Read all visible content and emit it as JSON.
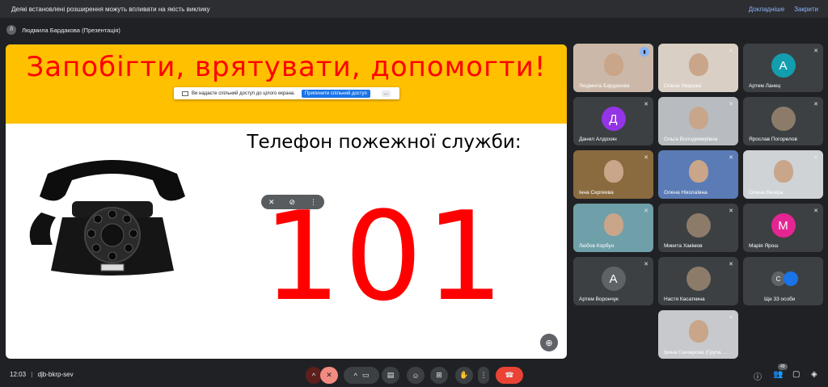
{
  "banner": {
    "message": "Деякі встановлені розширення можуть впливати на якість виклику",
    "details": "Докладніше",
    "close": "Закрити"
  },
  "presenter": {
    "initial": "Л",
    "label": "Людмила Бардакова (Презентація)"
  },
  "slide": {
    "title": "Запобігти, врятувати, допомогти!",
    "subtitle": "Телефон пожежної служби:",
    "number": "101",
    "share_notice": {
      "text": "Ви надаєте спільний доступ до цілого екрана.",
      "stop": "Припинити спільний доступ",
      "more": "..."
    }
  },
  "participants": [
    {
      "name": "Людмила Бардакова",
      "type": "video",
      "color": "#cbb8a8",
      "active": true
    },
    {
      "name": "Олена Уварова",
      "type": "video",
      "color": "#d9cfc4"
    },
    {
      "name": "Артем Ланец",
      "type": "avatar",
      "initial": "А",
      "color": "#129eaf"
    },
    {
      "name": "Данил Алдохин",
      "type": "avatar",
      "initial": "Д",
      "color": "#9334e6"
    },
    {
      "name": "Ольга Володимирівна",
      "type": "video",
      "color": "#b8bcc0"
    },
    {
      "name": "Ярослав Погорелов",
      "type": "photo",
      "color": "#3c4043"
    },
    {
      "name": "Інна Сергеева",
      "type": "video",
      "color": "#8a6b3f"
    },
    {
      "name": "Олена Ніколаївна",
      "type": "video",
      "color": "#5a7bb5"
    },
    {
      "name": "Олена Вегера",
      "type": "video",
      "color": "#cfd3d6"
    },
    {
      "name": "Любов Корбун",
      "type": "video",
      "color": "#6f9fa8"
    },
    {
      "name": "Микита Хакімов",
      "type": "photo",
      "color": "#3c4043"
    },
    {
      "name": "Марія Ярош",
      "type": "avatar",
      "initial": "М",
      "color": "#e52592"
    },
    {
      "name": "Артем Ворончук",
      "type": "avatar",
      "initial": "А",
      "color": "#5f6368"
    },
    {
      "name": "Настя Касаткина",
      "type": "photo",
      "color": "#3c4043"
    },
    {
      "name": "Ще 33 особи",
      "type": "more",
      "initial": "С",
      "color": "#5f6368"
    },
    {
      "name": "Ірина Гончарова (Група ...",
      "type": "video",
      "color": "#c7c9cc"
    }
  ],
  "bottom": {
    "time": "12:03",
    "separator": "|",
    "meeting_code": "djb-bkrp-sev",
    "people_count": "49"
  },
  "icons": {
    "mic_off": "mic-off-icon",
    "camera": "camera-icon",
    "captions": "captions-icon",
    "emoji": "emoji-icon",
    "present": "present-icon",
    "hand": "raise-hand-icon",
    "more": "more-vert-icon",
    "leave": "call-end-icon",
    "info": "info-icon",
    "people": "people-icon",
    "chat": "chat-icon",
    "activities": "activities-icon",
    "zoom": "zoom-icon",
    "pin": "pin-icon"
  }
}
